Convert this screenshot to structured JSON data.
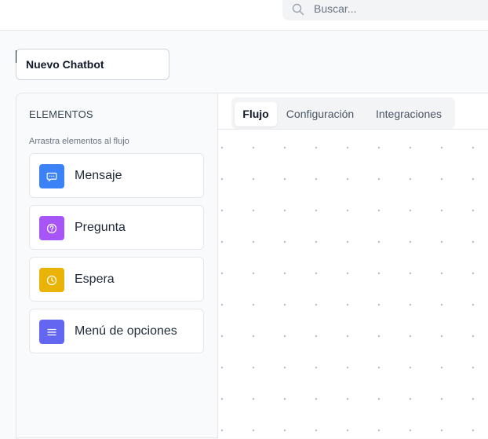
{
  "header": {
    "search": {
      "placeholder": "Buscar...",
      "icon": "search-icon"
    }
  },
  "chatbot": {
    "name": "Nuevo Chatbot"
  },
  "sidebar": {
    "title": "ELEMENTOS",
    "hint": "Arrastra elementos al flujo",
    "items": [
      {
        "label": "Mensaje",
        "icon": "message-icon",
        "color": "#3b82f6"
      },
      {
        "label": "Pregunta",
        "icon": "question-icon",
        "color": "#a855f7"
      },
      {
        "label": "Espera",
        "icon": "clock-icon",
        "color": "#eab308"
      },
      {
        "label": "Menú de opciones",
        "icon": "menu-icon",
        "color": "#6366f1"
      }
    ]
  },
  "tabs": {
    "items": [
      {
        "label": "Flujo",
        "active": true
      },
      {
        "label": "Configuración",
        "active": false
      },
      {
        "label": "Integraciones",
        "active": false
      }
    ]
  },
  "canvas": {
    "background": "#ffffff",
    "dot_color": "#9ca3af"
  }
}
